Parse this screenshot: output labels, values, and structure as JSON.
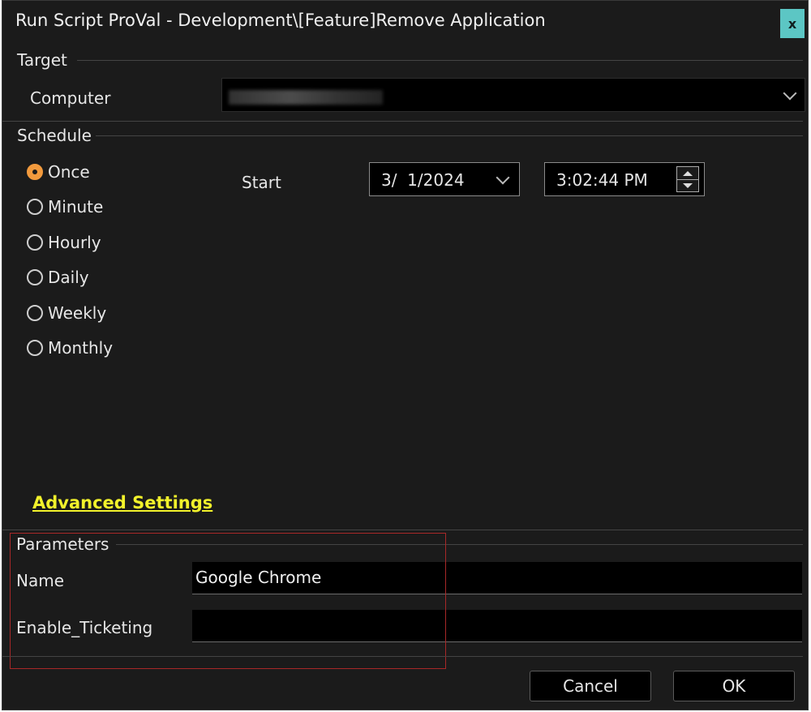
{
  "window": {
    "title": "Run Script ProVal - Development\\[Feature]Remove Application",
    "close_label": "x"
  },
  "target": {
    "group_label": "Target",
    "computer_label": "Computer",
    "computer_value": ""
  },
  "schedule": {
    "group_label": "Schedule",
    "options": [
      {
        "label": "Once",
        "checked": true
      },
      {
        "label": "Minute",
        "checked": false
      },
      {
        "label": "Hourly",
        "checked": false
      },
      {
        "label": "Daily",
        "checked": false
      },
      {
        "label": "Weekly",
        "checked": false
      },
      {
        "label": "Monthly",
        "checked": false
      }
    ],
    "start_label": "Start",
    "start_date": "3/  1/2024",
    "start_time": "3:02:44 PM"
  },
  "advanced_settings_label": "Advanced Settings",
  "parameters": {
    "group_label": "Parameters",
    "name_label": "Name",
    "name_value": "Google Chrome",
    "enable_ticketing_label": "Enable_Ticketing",
    "enable_ticketing_value": ""
  },
  "buttons": {
    "cancel": "Cancel",
    "ok": "OK"
  },
  "colors": {
    "accent_radio": "#f29a3d",
    "link": "#f2f22b",
    "close": "#5cc6c4",
    "highlight_box": "#a82828"
  }
}
